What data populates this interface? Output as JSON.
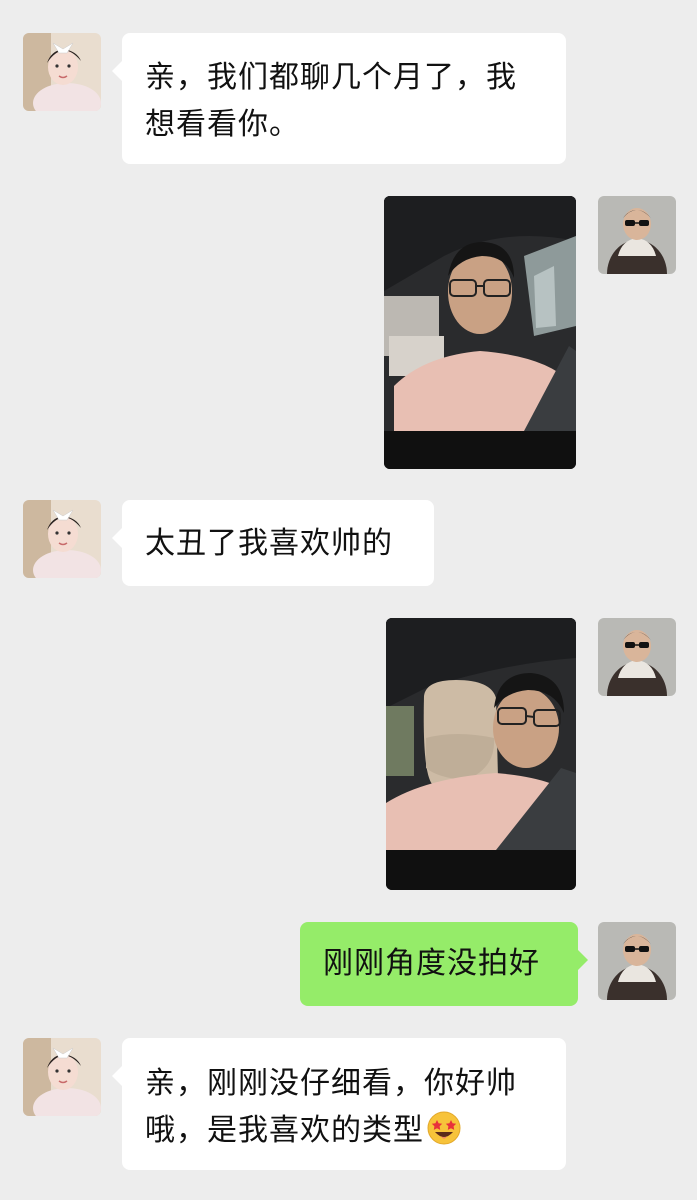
{
  "messages": [
    {
      "side": "left",
      "type": "text",
      "text": "亲，我们都聊几个月了，我想看看你。",
      "lines": [
        "亲，我们都聊几个月了，我",
        "想看看你。"
      ]
    },
    {
      "side": "right",
      "type": "image",
      "caption": "selfie-in-car"
    },
    {
      "side": "left",
      "type": "text",
      "text": "太丑了我喜欢帅的"
    },
    {
      "side": "right",
      "type": "image",
      "caption": "selfie-in-car-2"
    },
    {
      "side": "right",
      "type": "text",
      "text": "刚刚角度没拍好"
    },
    {
      "side": "left",
      "type": "text",
      "text": "亲，刚刚没仔细看，你好帅哦，是我喜欢的类型",
      "lines": [
        "亲，刚刚没仔细看，你好帅",
        "哦，是我喜欢的类型"
      ],
      "emoji": "star-struck-face-icon"
    }
  ],
  "colors": {
    "background": "#ededed",
    "incoming_bubble": "#ffffff",
    "outgoing_bubble": "#95ec69"
  }
}
